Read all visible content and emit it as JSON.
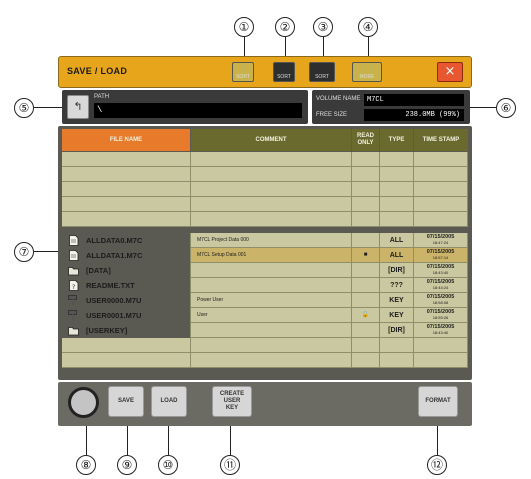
{
  "window": {
    "title": "SAVE / LOAD",
    "toolbar_buttons": [
      {
        "name": "icon-button-1",
        "label": "SORT"
      },
      {
        "name": "icon-button-2",
        "label": "SORT"
      },
      {
        "name": "icon-button-3",
        "label": "SORT"
      },
      {
        "name": "icon-button-4",
        "label": "MORE"
      }
    ],
    "close_glyph": "×"
  },
  "path": {
    "label": "PATH",
    "value": "\\",
    "up_glyph": "↰"
  },
  "volume": {
    "name_label": "VOLUME NAME",
    "name_value": "M7CL",
    "free_label": "FREE SIZE",
    "free_value": "238.0MB (99%)"
  },
  "table": {
    "columns": [
      "FILE NAME",
      "COMMENT",
      "READ ONLY",
      "TYPE",
      "TIME STAMP"
    ],
    "rows": [
      {
        "icon": "document-icon",
        "name": "ALLDATA0.M7C",
        "comment": "M7CL Project Data 000",
        "readonly": "",
        "type": "ALL",
        "date": "07/15/2005",
        "time": "18:47:24",
        "selected": false
      },
      {
        "icon": "document-icon",
        "name": "ALLDATA1.M7C",
        "comment": "M7CL Setup Data 001",
        "readonly": "■",
        "type": "ALL",
        "date": "07/15/2005",
        "time": "18:57:14",
        "selected": true
      },
      {
        "icon": "folder-icon",
        "name": "[DATA]",
        "comment": "",
        "readonly": "",
        "type": "[DIR]",
        "date": "07/15/2005",
        "time": "18:43:40",
        "selected": false
      },
      {
        "icon": "readme-icon",
        "name": "README.TXT",
        "comment": "",
        "readonly": "",
        "type": "???",
        "date": "07/15/2005",
        "time": "18:44:24",
        "selected": false
      },
      {
        "icon": "key-icon",
        "name": "USER0000.M7U",
        "comment": "Power User",
        "readonly": "",
        "type": "KEY",
        "date": "07/15/2005",
        "time": "18:58:08",
        "selected": false
      },
      {
        "icon": "key-icon",
        "name": "USER0001.M7U",
        "comment": "User",
        "readonly": "🔒",
        "type": "KEY",
        "date": "07/15/2005",
        "time": "18:59:26",
        "selected": false
      },
      {
        "icon": "folder-icon",
        "name": "[USERKEY]",
        "comment": "",
        "readonly": "",
        "type": "[DIR]",
        "date": "07/15/2005",
        "time": "18:43:40",
        "selected": false
      }
    ]
  },
  "bottom": {
    "save_label": "SAVE",
    "load_label": "LOAD",
    "create_label": "CREATE USER KEY",
    "format_label": "FORMAT"
  },
  "callouts": [
    "①",
    "②",
    "③",
    "④",
    "⑤",
    "⑥",
    "⑦",
    "⑧",
    "⑨",
    "⑩",
    "⑪",
    "⑫"
  ],
  "colors": {
    "titlebar": "#e6a51b",
    "header_accent": "#e87a2c",
    "header_olive": "#6b6a2e",
    "row_bg": "#c9c8a0",
    "selected_row": "#cbb46a",
    "close": "#e8572f"
  }
}
